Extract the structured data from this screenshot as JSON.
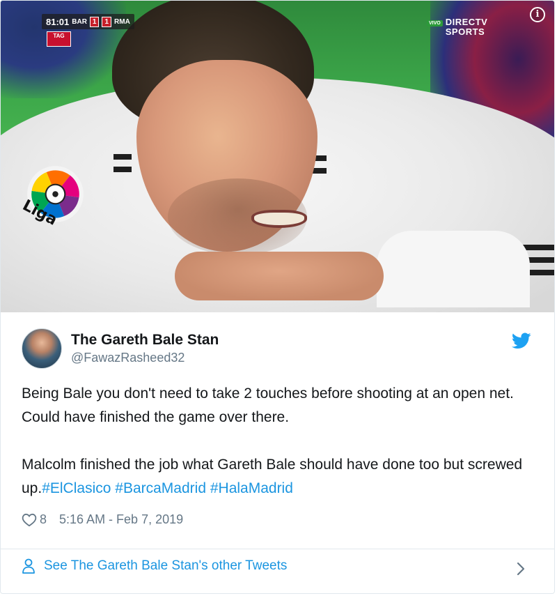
{
  "media": {
    "scorebug": {
      "clock": "81:01",
      "home_team": "BAR",
      "home_score": "1",
      "away_score": "1",
      "away_team": "RMA"
    },
    "sponsor_logo": "TAG",
    "broadcaster": {
      "live_label": "VIVO",
      "line1": "DIRECTV",
      "line2": "SPORTS"
    },
    "patch_text": "Liga",
    "info_icon": "info-icon"
  },
  "tweet": {
    "display_name": "The Gareth Bale Stan",
    "handle": "@FawazRasheed32",
    "paragraph1": "Being Bale you don't need to take 2 touches before shooting at an open net. Could have finished the game over there.",
    "paragraph2_text": "Malcolm finished the job what Gareth Bale should have done too but screwed up.",
    "hashtags": [
      "#ElClasico",
      "#BarcaMadrid",
      "#HalaMadrid"
    ],
    "likes": "8",
    "timestamp": "5:16 AM - Feb 7, 2019"
  },
  "footer": {
    "link_label": "See The Gareth Bale Stan's other Tweets"
  },
  "colors": {
    "link": "#1b95e0",
    "secondary_text": "#657786",
    "primary_text": "#14171a",
    "twitter_blue": "#1da1f2"
  },
  "icons": [
    "info-icon",
    "twitter-bird-icon",
    "heart-icon",
    "person-icon",
    "chevron-right-icon"
  ]
}
